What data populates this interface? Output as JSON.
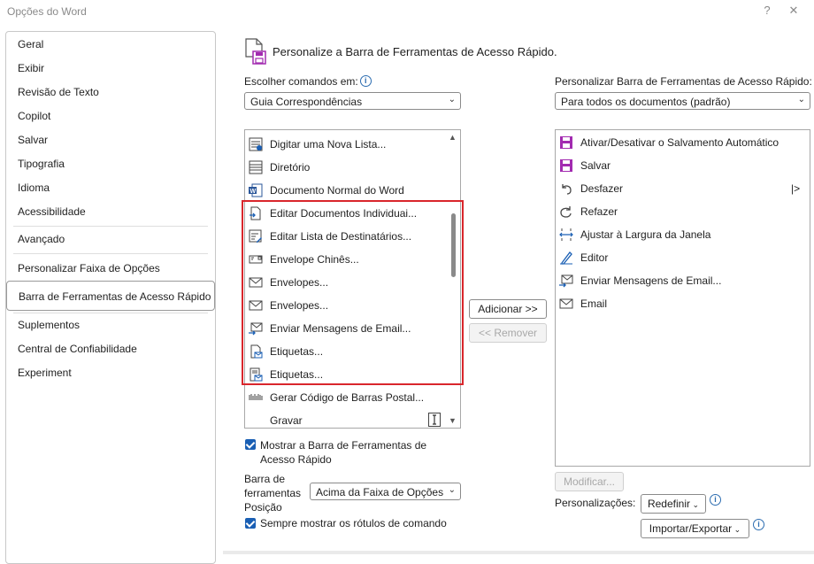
{
  "window": {
    "title": "Opções do Word",
    "help": "?",
    "close": "✕"
  },
  "sidebar": {
    "items": [
      {
        "label": "Geral"
      },
      {
        "label": "Exibir"
      },
      {
        "label": "Revisão de Texto"
      },
      {
        "label": "Copilot"
      },
      {
        "label": "Salvar"
      },
      {
        "label": "Tipografia"
      },
      {
        "label": "Idioma"
      },
      {
        "label": "Acessibilidade"
      },
      {
        "label": "Avançado"
      },
      {
        "label": "Personalizar Faixa de Opções"
      },
      {
        "label": "Barra de Ferramentas de Acesso Rápido"
      },
      {
        "label": "Suplementos"
      },
      {
        "label": "Central de Confiabilidade"
      },
      {
        "label": "Experiment"
      }
    ]
  },
  "header": {
    "title": "Personalize a Barra de Ferramentas de Acesso Rápido."
  },
  "left": {
    "choose_label": "Escolher comandos em:",
    "choose_value": "Guia Correspondências",
    "commands": [
      {
        "label": "Digitar uma Nova Lista...",
        "icon": "new-list-icon"
      },
      {
        "label": "Diretório",
        "icon": "directory-icon"
      },
      {
        "label": "Documento Normal do Word",
        "icon": "word-document-icon"
      },
      {
        "label": "Editar Documentos Individuai...",
        "icon": "edit-individual-documents-icon"
      },
      {
        "label": "Editar Lista de Destinatários...",
        "icon": "edit-recipient-list-icon"
      },
      {
        "label": "Envelope Chinês...",
        "icon": "chinese-envelope-icon"
      },
      {
        "label": "Envelopes...",
        "icon": "envelope-icon"
      },
      {
        "label": "Envelopes...",
        "icon": "envelope-icon"
      },
      {
        "label": "Enviar Mensagens de Email...",
        "icon": "send-email-icon"
      },
      {
        "label": "Etiquetas...",
        "icon": "labels-icon"
      },
      {
        "label": "Etiquetas...",
        "icon": "labels-icon"
      },
      {
        "label": "Gerar Código de Barras Postal...",
        "icon": "postal-barcode-icon"
      },
      {
        "label": "Gravar",
        "icon": "record-icon"
      }
    ],
    "show_toolbar_label": "Mostrar a Barra de Ferramentas de Acesso Rápido",
    "position_label_1": "Barra de",
    "position_label_2": "ferramentas",
    "position_label_3": "Posição",
    "position_value": "Acima da Faixa de Opções",
    "always_show_label": "Sempre mostrar os rótulos de comando"
  },
  "middle": {
    "add_button": "Adicionar >>",
    "remove_button": "<< Remover"
  },
  "right": {
    "customize_label": "Personalizar Barra de Ferramentas de Acesso Rápido:",
    "customize_value": "Para todos os documentos (padrão)",
    "items": [
      {
        "label": "Ativar/Desativar o Salvamento Automático",
        "icon": "autosave-icon"
      },
      {
        "label": "Salvar",
        "icon": "save-icon"
      },
      {
        "label": "Desfazer",
        "icon": "undo-icon"
      },
      {
        "label": "Refazer",
        "icon": "redo-icon"
      },
      {
        "label": "Ajustar à Largura da Janela",
        "icon": "fit-width-icon"
      },
      {
        "label": "Editor",
        "icon": "editor-icon"
      },
      {
        "label": "Enviar Mensagens de Email...",
        "icon": "send-email-icon"
      },
      {
        "label": "Email",
        "icon": "email-icon"
      }
    ],
    "modify_button": "Modificar...",
    "personalizations_label": "Personalizações:",
    "reset_button": "Redefinir",
    "import_export_button": "Importar/Exportar"
  },
  "colors": {
    "highlight": "#d9262c",
    "accent": "#1a5fb4",
    "save_icon": "#a22bb0"
  }
}
